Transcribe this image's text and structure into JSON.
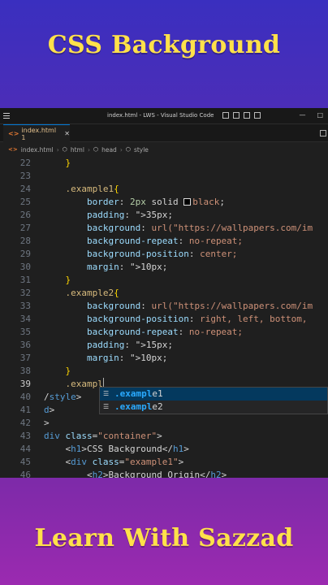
{
  "banner": {
    "top_title": "CSS Background",
    "bottom_title": "Learn With Sazzad"
  },
  "window": {
    "title": "index.html - LWS - Visual Studio Code",
    "controls": [
      "—",
      "□"
    ]
  },
  "tab": {
    "label": "index.html 1",
    "close": "✕"
  },
  "breadcrumb": {
    "file": "index.html",
    "items": [
      "html",
      "head",
      "style"
    ]
  },
  "editor": {
    "lines": [
      {
        "n": "22",
        "code": "    }"
      },
      {
        "n": "23",
        "code": ""
      },
      {
        "n": "24",
        "code": "    .example1{"
      },
      {
        "n": "25",
        "code": "        border: 2px solid black;"
      },
      {
        "n": "26",
        "code": "        padding: 35px;"
      },
      {
        "n": "27",
        "code": "        background: url(\"https://wallpapers.com/im"
      },
      {
        "n": "28",
        "code": "        background-repeat: no-repeat;"
      },
      {
        "n": "29",
        "code": "        background-position: center;"
      },
      {
        "n": "30",
        "code": "        margin: 10px;"
      },
      {
        "n": "31",
        "code": "    }"
      },
      {
        "n": "32",
        "code": "    .example2{"
      },
      {
        "n": "33",
        "code": "        background: url(\"https://wallpapers.com/im"
      },
      {
        "n": "34",
        "code": "        background-position: right, left, bottom,"
      },
      {
        "n": "35",
        "code": "        background-repeat: no-repeat;"
      },
      {
        "n": "36",
        "code": "        padding: 15px;"
      },
      {
        "n": "37",
        "code": "        margin: 10px;"
      },
      {
        "n": "38",
        "code": "    }"
      },
      {
        "n": "39",
        "code": "    .exampl"
      },
      {
        "n": "40",
        "code": "/style>"
      },
      {
        "n": "41",
        "code": "d>"
      },
      {
        "n": "42",
        "code": ">"
      },
      {
        "n": "43",
        "code": "div class=\"container\">"
      },
      {
        "n": "44",
        "code": "    <h1>CSS Background</h1>"
      },
      {
        "n": "45",
        "code": "    <div class=\"example1\">"
      },
      {
        "n": "46",
        "code": "        <h2>Background Origin</h2>"
      }
    ]
  },
  "suggestions": [
    {
      "match": ".exampl",
      "rest": "e1"
    },
    {
      "match": ".exampl",
      "rest": "e2"
    }
  ],
  "colors": {
    "accent": "#0078d4",
    "banner_text": "#ffe14a",
    "editor_bg": "#1f1f1f"
  }
}
